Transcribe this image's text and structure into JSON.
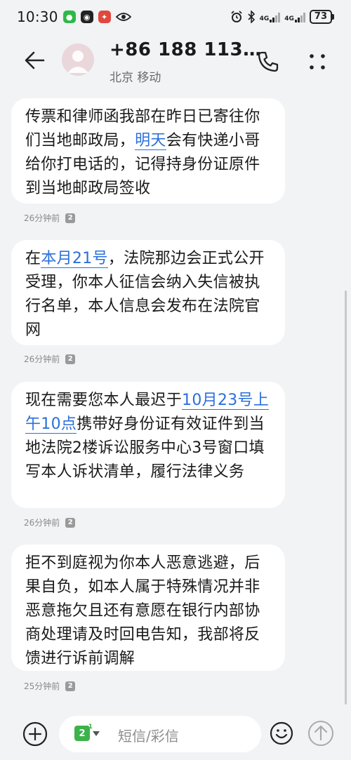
{
  "status_bar": {
    "time": "10:30",
    "net1": "4G",
    "net2": "4G",
    "battery": "73"
  },
  "header": {
    "contact": "+86 188 113…",
    "subtitle": "北京 移动"
  },
  "messages": [
    {
      "parts": [
        {
          "text": "传票和律师函我部在昨日已寄往你们当地邮政局，",
          "link": false
        },
        {
          "text": "明天",
          "link": true
        },
        {
          "text": "会有快递小哥给你打电话的，记得持身份证原件到当地邮政局签收",
          "link": false
        }
      ],
      "time": "26分钟前",
      "sim": "2"
    },
    {
      "parts": [
        {
          "text": "在",
          "link": false
        },
        {
          "text": "本月21号",
          "link": true
        },
        {
          "text": "，法院那边会正式公开受理，你本人征信会纳入失信被执行名单，本人信息会发布在法院官网",
          "link": false
        }
      ],
      "time": "26分钟前",
      "sim": "2"
    },
    {
      "parts": [
        {
          "text": "现在需要您本人最迟于",
          "link": false
        },
        {
          "text": "10月23号上午10点",
          "link": true
        },
        {
          "text": "携带好身份证有效证件到当地法院2楼诉讼服务中心3号窗口填写本人诉状清单，履行法律义务",
          "link": false
        }
      ],
      "time": "26分钟前",
      "sim": "2"
    },
    {
      "parts": [
        {
          "text": "拒不到庭视为你本人恶意逃避，后果自负，如本人属于特殊情况并非恶意拖欠且还有意愿在银行内部协商处理请及时回电告知，我部将反馈进行诉前调解",
          "link": false
        }
      ],
      "time": "25分钟前",
      "sim": "2"
    }
  ],
  "input": {
    "sim_label": "2",
    "sim_badge": "1",
    "placeholder": "短信/彩信"
  },
  "colors": {
    "link": "#2a6fdb",
    "sim_green": "#3cb34a",
    "background": "#f1f3f5"
  }
}
